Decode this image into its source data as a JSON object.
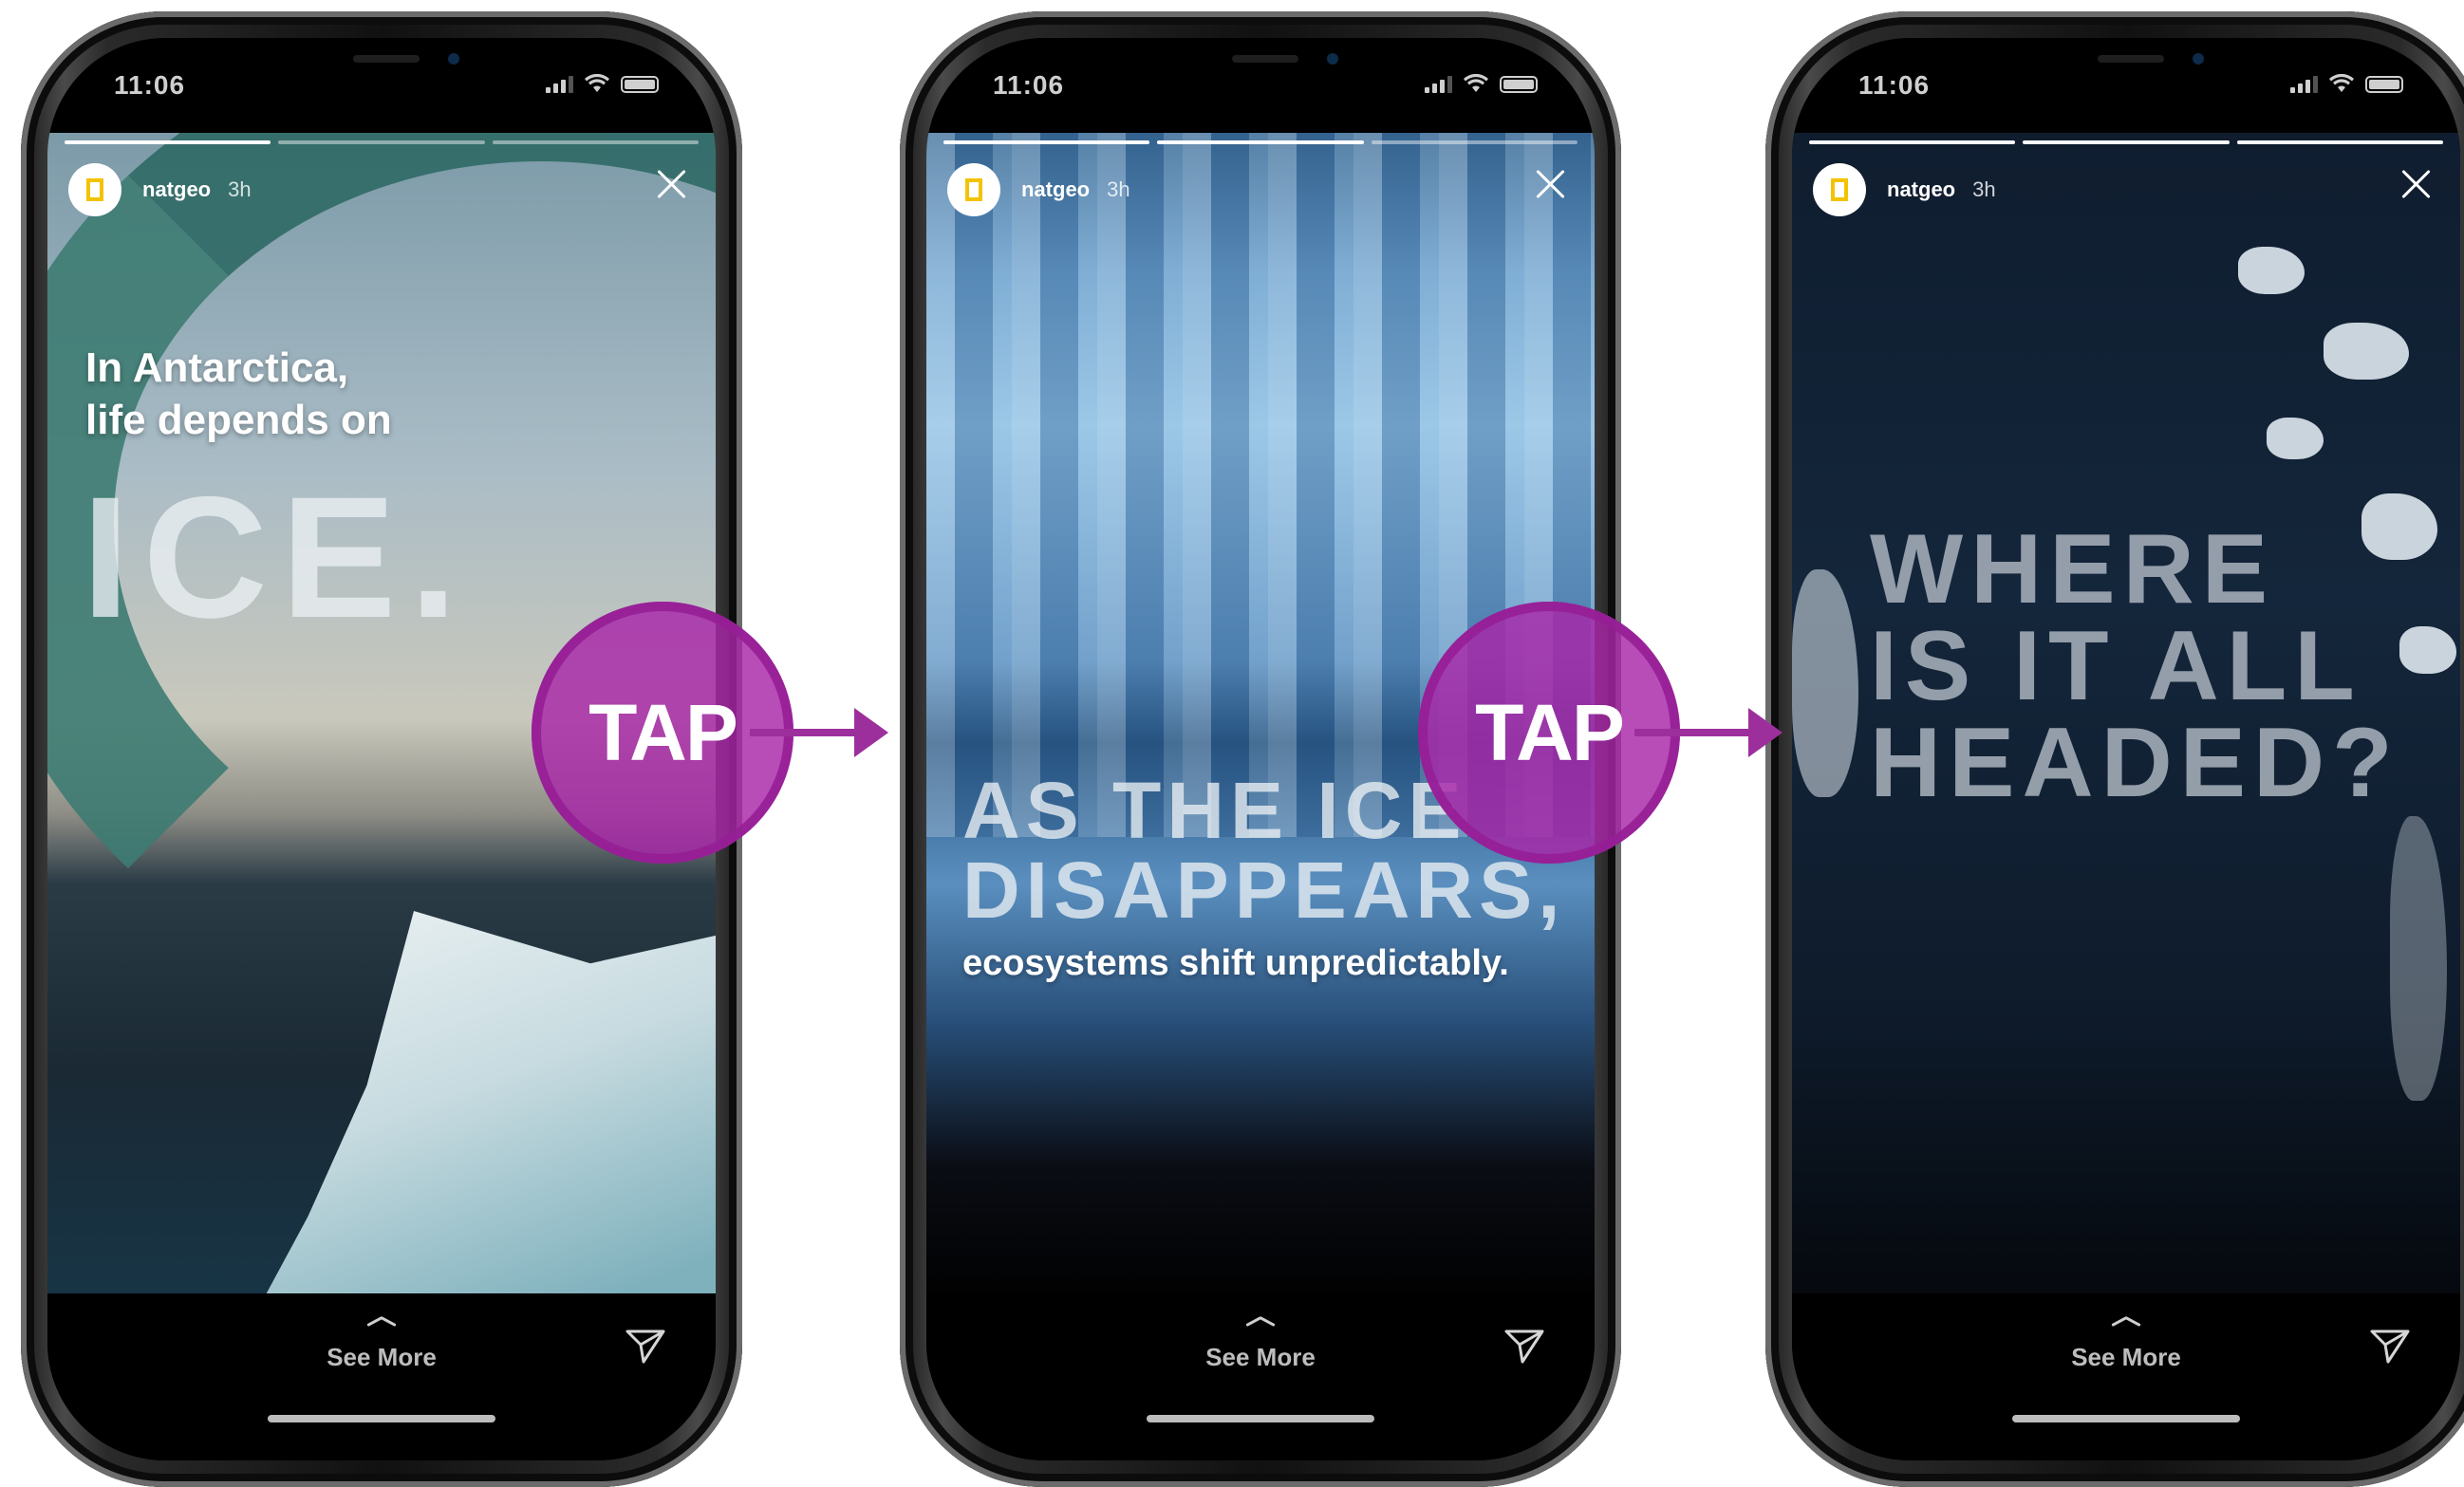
{
  "phones": [
    {
      "time": "11:06",
      "username": "natgeo",
      "age": "3h",
      "caption_line1": "In Antarctica,",
      "caption_line2": "life depends on",
      "caption_big": "ICE.",
      "see_more": "See More"
    },
    {
      "time": "11:06",
      "username": "natgeo",
      "age": "3h",
      "caption_big_line1": "AS THE ICE",
      "caption_big_line2": "DISAPPEARS,",
      "caption_small": "ecosystems shift unpredictably.",
      "see_more": "See More"
    },
    {
      "time": "11:06",
      "username": "natgeo",
      "age": "3h",
      "caption_big_line1": "WHERE",
      "caption_big_line2": "IS IT ALL",
      "caption_big_line3": "HEADED?",
      "see_more": "See More"
    }
  ],
  "tap_labels": [
    "TAP",
    "TAP"
  ],
  "colors": {
    "tap_circle": "#a826a8",
    "arrow": "#9d2f9d",
    "natgeo_yellow": "#f3c300"
  },
  "icons": [
    "location-arrow-icon",
    "signal-icon",
    "wifi-icon",
    "battery-icon",
    "close-icon",
    "chevron-up-icon",
    "send-icon",
    "natgeo-logo"
  ]
}
